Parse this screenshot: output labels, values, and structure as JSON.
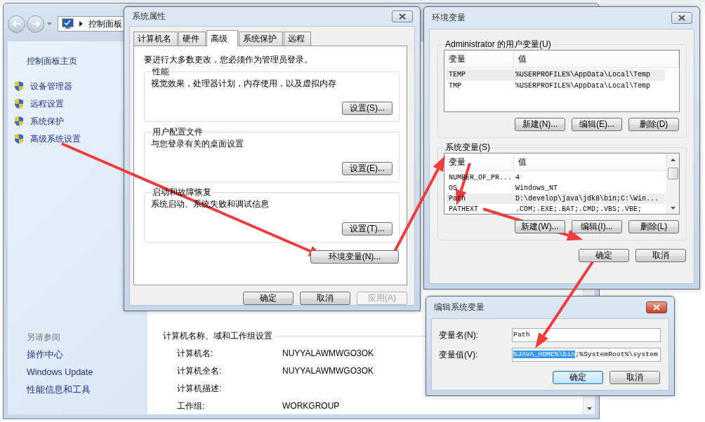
{
  "control_panel": {
    "breadcrumb": "控制面板",
    "sidebar": {
      "home": "控制面板主页",
      "tasks": [
        "设备管理器",
        "远程设置",
        "系统保护",
        "高级系统设置"
      ],
      "see_also_heading": "另请参阅",
      "see_also": [
        "操作中心",
        "Windows Update",
        "性能信息和工具"
      ]
    },
    "computer_section": {
      "heading": "计算机名称、域和工作组设置",
      "rows": [
        {
          "label": "计算机名:",
          "value": "NUYYALAWMWGO3OK"
        },
        {
          "label": "计算机全名:",
          "value": "NUYYALAWMWGO3OK"
        },
        {
          "label": "计算机描述:"
        },
        {
          "label": "工作组:",
          "value": "WORKGROUP"
        }
      ]
    }
  },
  "system_properties": {
    "title": "系统属性",
    "tabs": [
      {
        "label": "计算机名",
        "selected": false
      },
      {
        "label": "硬件",
        "selected": false
      },
      {
        "label": "高级",
        "selected": true
      },
      {
        "label": "系统保护",
        "selected": false
      },
      {
        "label": "远程",
        "selected": false
      }
    ],
    "admin_note": "要进行大多数更改，您必须作为管理员登录。",
    "groups": [
      {
        "title": "性能",
        "description": "视觉效果，处理器计划，内存使用，以及虚拟内存",
        "button": "设置(S)..."
      },
      {
        "title": "用户配置文件",
        "description": "与您登录有关的桌面设置",
        "button": "设置(E)..."
      },
      {
        "title": "启动和故障恢复",
        "description": "系统启动、系统失败和调试信息",
        "button": "设置(T)..."
      }
    ],
    "env_button": "环境变量(N)...",
    "buttons": [
      {
        "label": "确定",
        "disabled": false
      },
      {
        "label": "取消",
        "disabled": false
      },
      {
        "label": "应用(A)",
        "disabled": true
      }
    ]
  },
  "environment_variables": {
    "title": "环境变量",
    "user_variables": {
      "title": "Administrator 的用户变量(U)",
      "columns": [
        "变量",
        "值"
      ],
      "rows": [
        {
          "name": "TEMP",
          "value": "%USERPROFILE%\\AppData\\Local\\Temp",
          "selected": true
        },
        {
          "name": "TMP",
          "value": "%USERPROFILE%\\AppData\\Local\\Temp",
          "selected": false
        }
      ],
      "buttons": [
        "新建(N)...",
        "编辑(E)...",
        "删除(D)"
      ]
    },
    "system_variables": {
      "title": "系统变量(S)",
      "columns": [
        "变量",
        "值"
      ],
      "rows": [
        {
          "name": "NUMBER_OF_PR...",
          "value": "4",
          "selected": false
        },
        {
          "name": "OS",
          "value": "Windows_NT",
          "selected": false
        },
        {
          "name": "Path",
          "value": "D:\\develop\\java\\jdk8\\bin;C:\\Win...",
          "selected": true
        },
        {
          "name": "PATHEXT",
          "value": ".COM;.EXE;.BAT;.CMD;.VBS;.VBE;",
          "selected": false
        }
      ],
      "buttons": [
        "新建(W)...",
        "编辑(I)...",
        "删除(L)"
      ]
    },
    "buttons": [
      "确定",
      "取消"
    ]
  },
  "edit_variable": {
    "title": "编辑系统变量",
    "fields": [
      {
        "label": "变量名(N):",
        "value": "Path"
      },
      {
        "label": "变量值(V):",
        "selected_text": "%JAVA_HOME%\\bin",
        "value": ";%SystemRoot%\\system"
      }
    ],
    "buttons": [
      {
        "label": "确定",
        "default": true
      },
      {
        "label": "取消",
        "default": false
      }
    ]
  }
}
